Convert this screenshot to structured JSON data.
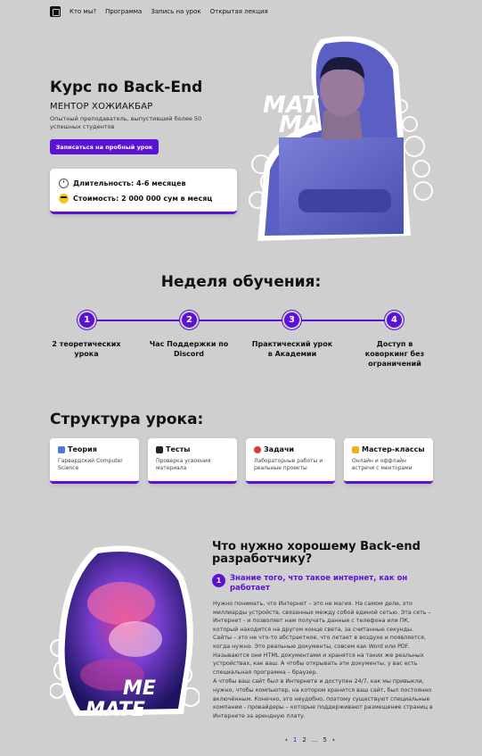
{
  "nav": {
    "items": [
      "Кто мы?",
      "Программа",
      "Запись на урок",
      "Открытая лекция"
    ]
  },
  "hero": {
    "title": "Курс по Back-End",
    "mentor": "МЕНТОР ХОЖИАКБАР",
    "description": "Опытный преподаватель, выпустивший более 50 успешных студентов",
    "cta": "Записаться на пробный урок",
    "info": {
      "duration": "Длительность: 4-6 месяцев",
      "price": "Стоимость: 2 000 000 сум в месяц"
    },
    "watermark": "MATE"
  },
  "week": {
    "title": "Неделя обучения:",
    "steps": [
      {
        "num": "1",
        "label": "2 теоретических урока"
      },
      {
        "num": "2",
        "label": "Час Поддержки по Discord"
      },
      {
        "num": "3",
        "label": "Практический урок в Академии"
      },
      {
        "num": "4",
        "label": "Доступ в коворкинг без ограничений"
      }
    ]
  },
  "structure": {
    "title": "Структура урока:",
    "cards": [
      {
        "title": "Теория",
        "desc": "Гарвардский Computer Science"
      },
      {
        "title": "Тесты",
        "desc": "Проверка усвоения материала"
      },
      {
        "title": "Задачи",
        "desc": "Лабораторные работы и реальные проекты"
      },
      {
        "title": "Мастер-классы",
        "desc": "Онлайн и оффлайн встречи с менторами"
      }
    ]
  },
  "question": {
    "title": "Что нужно хорошему Back-end разработчику?",
    "item_num": "1",
    "item_title": "Знание того, что такое интернет, как он работает",
    "body1": "Нужно понимать, что Интернет – это не магия. На самом деле, это миллиарды устройств, связанных между собой единой сетью. Эта сеть – Интернет - и позволяет нам получать данные с телефона или ПК, который находится на другом конце света, за считанные секунды. Сайты – это не что-то абстрактное, что летает в воздухе и появляется, когда нужно. Это реальные документы, совсем как Word или PDF. Называются они HTML документами и хранятся на таких же реальных устройствах, как ваш. А чтобы открывать эти документы, у вас есть специальная программа – браузер.",
    "body2": " А чтобы ваш сайт был в Интернете и доступен 24/7, как мы привыкли, нужно, чтобы компьютер, на котором хранится ваш сайт, был постоянно включённым. Конечно, это неудобно, поэтому существуют специальные компании - провайдеры – которые поддерживают размещение страниц в Интернете за арендную плату.",
    "watermark": "MATE"
  },
  "pager": {
    "prev": "‹",
    "pages": [
      "1",
      "2",
      "...",
      "5"
    ],
    "next": "›"
  },
  "colors": {
    "accent": "#5b12d4",
    "background": "#cfcfcf"
  }
}
